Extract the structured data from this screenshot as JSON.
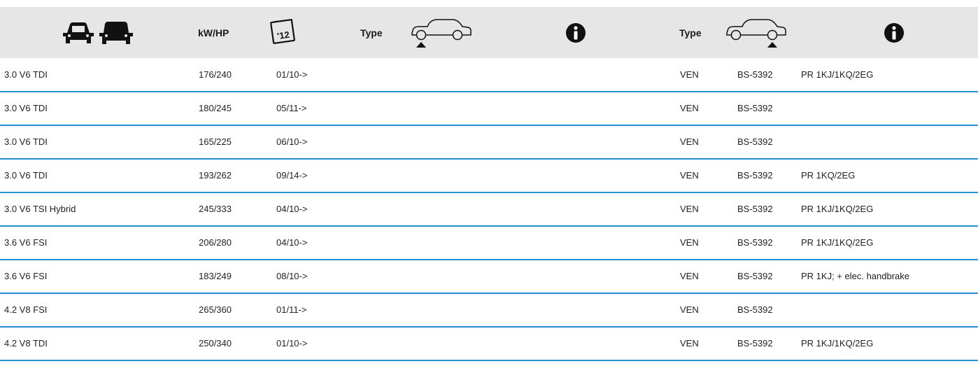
{
  "header": {
    "vehicles_icon": "two-cars-icon",
    "power_label": "kW/HP",
    "date_icon": "calendar-icon",
    "calendar_text": "'12",
    "front": {
      "type_label": "Type",
      "axle_icon": "car-front-axle-icon",
      "info_icon": "info-icon"
    },
    "rear": {
      "type_label": "Type",
      "axle_icon": "car-rear-axle-icon",
      "info_icon": "info-icon"
    }
  },
  "colors": {
    "header_bg": "#e6e6e6",
    "row_divider": "#2a8fd1"
  },
  "rows": [
    {
      "model": "3.0 V6 TDI",
      "power": "176/240",
      "date": "01/10->",
      "type": "VEN",
      "part": "BS-5392",
      "info": "PR 1KJ/1KQ/2EG"
    },
    {
      "model": "3.0 V6 TDI",
      "power": "180/245",
      "date": "05/11->",
      "type": "VEN",
      "part": "BS-5392",
      "info": ""
    },
    {
      "model": "3.0 V6 TDI",
      "power": "165/225",
      "date": "06/10->",
      "type": "VEN",
      "part": "BS-5392",
      "info": ""
    },
    {
      "model": "3.0 V6 TDI",
      "power": "193/262",
      "date": "09/14->",
      "type": "VEN",
      "part": "BS-5392",
      "info": "PR 1KQ/2EG"
    },
    {
      "model": "3.0 V6 TSI Hybrid",
      "power": "245/333",
      "date": "04/10->",
      "type": "VEN",
      "part": "BS-5392",
      "info": "PR 1KJ/1KQ/2EG"
    },
    {
      "model": "3.6 V6 FSI",
      "power": "206/280",
      "date": "04/10->",
      "type": "VEN",
      "part": "BS-5392",
      "info": "PR 1KJ/1KQ/2EG"
    },
    {
      "model": "3.6 V6 FSI",
      "power": "183/249",
      "date": "08/10->",
      "type": "VEN",
      "part": "BS-5392",
      "info": "PR 1KJ; + elec. handbrake"
    },
    {
      "model": "4.2 V8 FSI",
      "power": "265/360",
      "date": "01/11->",
      "type": "VEN",
      "part": "BS-5392",
      "info": ""
    },
    {
      "model": "4.2 V8 TDI",
      "power": "250/340",
      "date": "01/10->",
      "type": "VEN",
      "part": "BS-5392",
      "info": "PR 1KJ/1KQ/2EG"
    }
  ]
}
